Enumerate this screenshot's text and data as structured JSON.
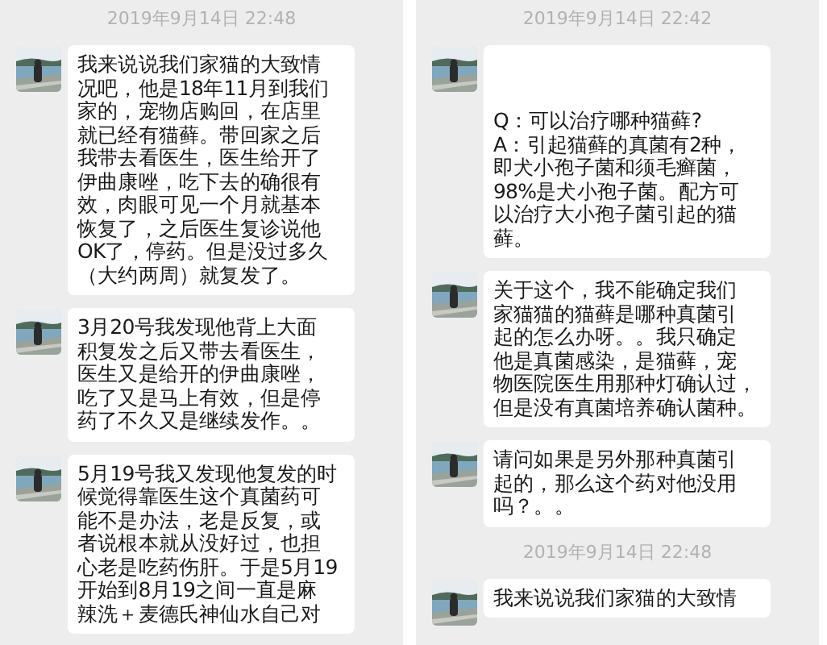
{
  "panels": [
    {
      "items": [
        {
          "kind": "time",
          "text": "2019年9月14日 22:48"
        },
        {
          "kind": "message",
          "lines": [
            "我来说说我们家猫的大致情",
            "况吧，他是18年11月到我们",
            "家的，宠物店购回，在店里",
            "就已经有猫藓。带回家之后",
            "我带去看医生，医生给开了",
            "伊曲康唑，吃下去的确很有",
            "效，肉眼可见一个月就基本",
            "恢复了，之后医生复诊说他",
            "OK了，停药。但是没过多久",
            "（大约两周）就复发了。"
          ]
        },
        {
          "kind": "message",
          "lines": [
            "3月20号我发现他背上大面",
            "积复发之后又带去看医生，",
            "医生又是给开的伊曲康唑，",
            "吃了又是马上有效，但是停",
            "药了不久又是继续发作。。"
          ]
        },
        {
          "kind": "message",
          "lines": [
            "5月19号我又发现他复发的时",
            "候觉得靠医生这个真菌药可",
            "能不是办法，老是反复，或",
            "者说根本就从没好过，也担",
            "心老是吃药伤肝。于是5月19",
            "开始到8月19之间一直是麻",
            "辣洗＋麦德氏神仙水自己对"
          ]
        }
      ]
    },
    {
      "items": [
        {
          "kind": "time",
          "text": "2019年9月14日 22:42"
        },
        {
          "kind": "spaced_message",
          "lines": [
            "Q：可以治疗哪种猫藓?",
            "A：引起猫藓的真菌有2种，",
            "即犬小孢子菌和须毛癣菌，",
            "98%是犬小孢子菌。配方可",
            "以治疗大小孢子菌引起的猫",
            "藓。"
          ]
        },
        {
          "kind": "message",
          "lines": [
            "关于这个，我不能确定我们",
            "家猫猫的猫藓是哪种真菌引",
            "起的怎么办呀。。我只确定",
            "他是真菌感染，是猫藓，宠",
            "物医院医生用那种灯确认过，",
            "但是没有真菌培养确认菌种。"
          ]
        },
        {
          "kind": "message",
          "lines": [
            "请问如果是另外那种真菌引",
            "起的，那么这个药对他没用",
            "吗？。。"
          ]
        },
        {
          "kind": "time",
          "text": "2019年9月14日 22:48"
        },
        {
          "kind": "message",
          "lines": [
            "我来说说我们家猫的大致情"
          ]
        }
      ]
    }
  ]
}
